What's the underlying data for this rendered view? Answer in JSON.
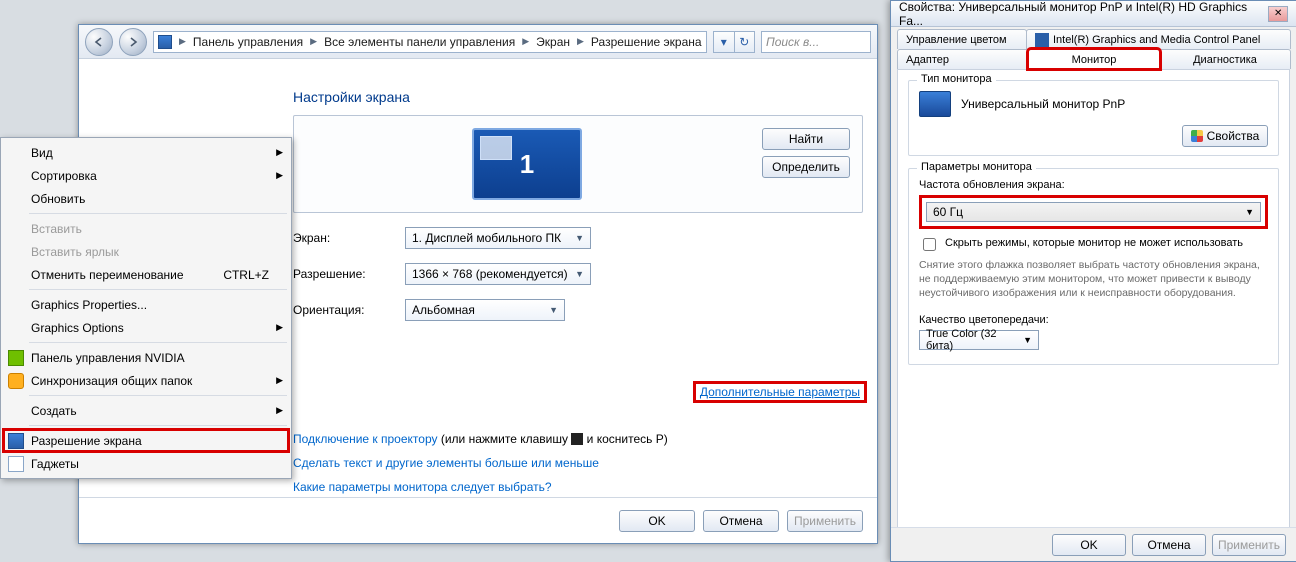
{
  "cp": {
    "breadcrumbs": [
      "Панель управления",
      "Все элементы панели управления",
      "Экран",
      "Разрешение экрана"
    ],
    "search_placeholder": "Поиск в...",
    "title": "Настройки экрана",
    "monitor_number": "1",
    "btn_find": "Найти",
    "btn_detect": "Определить",
    "lbl_screen": "Экран:",
    "val_screen": "1. Дисплей мобильного ПК",
    "lbl_resolution": "Разрешение:",
    "val_resolution": "1366 × 768 (рекомендуется)",
    "lbl_orientation": "Ориентация:",
    "val_orientation": "Альбомная",
    "advanced": "Дополнительные параметры",
    "link_projector_a": "Подключение к проектору",
    "link_projector_b": " (или нажмите клавишу ",
    "link_projector_c": " и коснитесь P)",
    "link_textsize": "Сделать текст и другие элементы больше или меньше",
    "link_which": "Какие параметры монитора следует выбрать?",
    "btn_ok": "OK",
    "btn_cancel": "Отмена",
    "btn_apply": "Применить"
  },
  "ctx": {
    "view": "Вид",
    "sort": "Сортировка",
    "refresh": "Обновить",
    "paste": "Вставить",
    "paste_shortcut": "Вставить ярлык",
    "undo_rename": "Отменить переименование",
    "undo_shortcut": "CTRL+Z",
    "gfx_props": "Graphics Properties...",
    "gfx_options": "Graphics Options",
    "nvidia": "Панель управления NVIDIA",
    "sync": "Синхронизация общих папок",
    "create": "Создать",
    "resolution": "Разрешение экрана",
    "gadgets": "Гаджеты"
  },
  "dlg": {
    "title": "Свойства: Универсальный монитор PnP и Intel(R) HD Graphics Fa...",
    "tab_color": "Управление цветом",
    "tab_intel": "Intel(R) Graphics and Media Control Panel",
    "tab_adapter": "Адаптер",
    "tab_monitor": "Монитор",
    "tab_diag": "Диагностика",
    "grp_type": "Тип монитора",
    "mon_name": "Универсальный монитор PnP",
    "btn_props": "Свойства",
    "grp_settings": "Параметры монитора",
    "lbl_freq": "Частота обновления экрана:",
    "val_freq": "60 Гц",
    "chk_hide": "Скрыть режимы, которые монитор не может использовать",
    "note": "Снятие этого флажка позволяет выбрать частоту обновления экрана, не поддерживаемую этим монитором, что может привести к выводу неустойчивого изображения или к неисправности оборудования.",
    "lbl_quality": "Качество цветопередачи:",
    "val_quality": "True Color (32 бита)",
    "btn_ok": "OK",
    "btn_cancel": "Отмена",
    "btn_apply": "Применить"
  }
}
